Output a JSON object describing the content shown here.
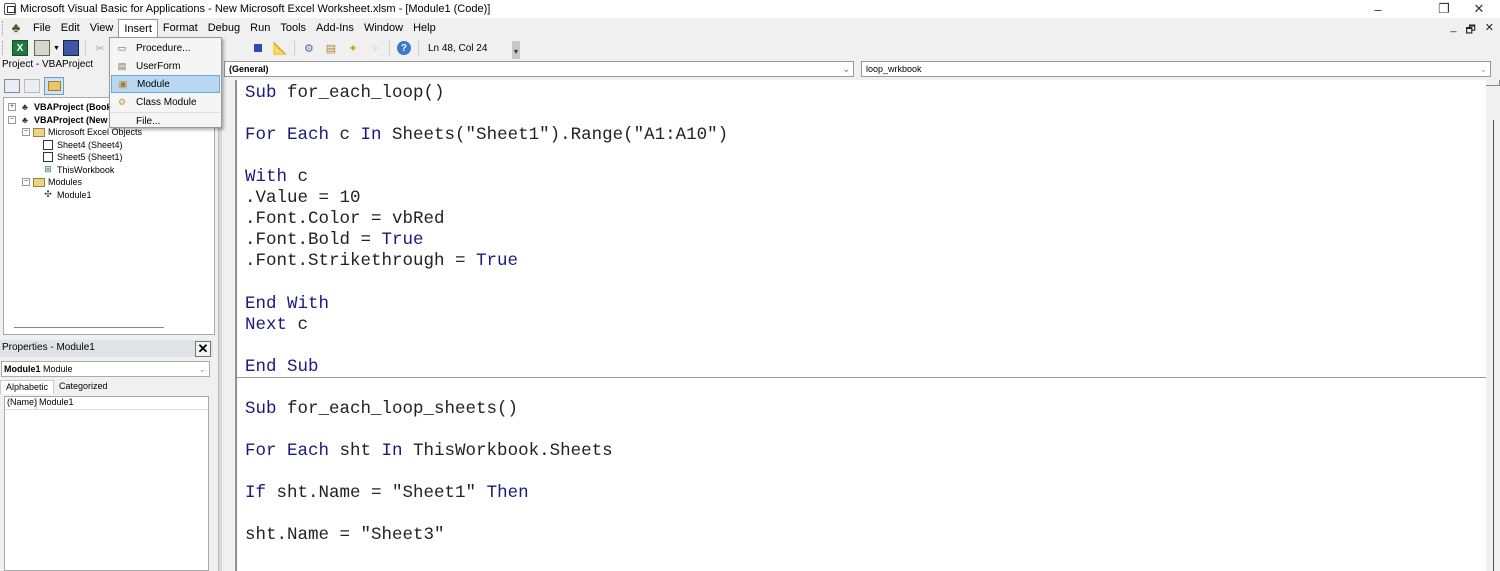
{
  "window": {
    "title": "Microsoft Visual Basic for Applications - New Microsoft Excel Worksheet.xlsm - [Module1 (Code)]",
    "controls": {
      "minimize": "–",
      "restore": "❐",
      "close": "✕"
    },
    "mdi_controls": {
      "minimize": "_",
      "restore": "🗗",
      "close": "✕"
    }
  },
  "menubar": {
    "items": [
      "File",
      "Edit",
      "View",
      "Insert",
      "Format",
      "Debug",
      "Run",
      "Tools",
      "Add-Ins",
      "Window",
      "Help"
    ],
    "open_menu": "Insert"
  },
  "insert_menu": {
    "items": [
      {
        "label": "Procedure...",
        "icon": "procedure-icon",
        "highlighted": false
      },
      {
        "label": "UserForm",
        "icon": "userform-icon",
        "highlighted": false
      },
      {
        "label": "Module",
        "icon": "module-icon",
        "highlighted": true
      },
      {
        "label": "Class Module",
        "icon": "class-module-icon",
        "highlighted": false
      },
      {
        "label": "File...",
        "icon": "",
        "highlighted": false
      }
    ]
  },
  "toolbar": {
    "status": "Ln 48, Col 24",
    "icons": [
      "excel-view-icon",
      "insert-userform-icon",
      "save-icon",
      "cut-icon",
      "copy-icon",
      "reset-icon",
      "design-mode-icon",
      "project-explorer-icon",
      "properties-window-icon",
      "object-browser-icon",
      "toolbox-icon",
      "help-icon"
    ]
  },
  "project_panel": {
    "title": "Project - VBAProject",
    "tree": [
      {
        "label": "VBAProject (Book",
        "level": 0,
        "bold": true,
        "expander": "+",
        "icon": "vba-project-icon"
      },
      {
        "label": "VBAProject (New",
        "level": 0,
        "bold": true,
        "expander": "−",
        "icon": "vba-project-icon"
      },
      {
        "label": "Microsoft Excel Objects",
        "level": 1,
        "bold": false,
        "expander": "−",
        "icon": "folder-icon"
      },
      {
        "label": "Sheet4 (Sheet4)",
        "level": 2,
        "bold": false,
        "expander": "",
        "icon": "sheet-icon"
      },
      {
        "label": "Sheet5 (Sheet1)",
        "level": 2,
        "bold": false,
        "expander": "",
        "icon": "sheet-icon"
      },
      {
        "label": "ThisWorkbook",
        "level": 2,
        "bold": false,
        "expander": "",
        "icon": "workbook-icon"
      },
      {
        "label": "Modules",
        "level": 1,
        "bold": false,
        "expander": "−",
        "icon": "folder-icon"
      },
      {
        "label": "Module1",
        "level": 2,
        "bold": false,
        "expander": "",
        "icon": "module-icon"
      }
    ]
  },
  "properties_panel": {
    "title": "Properties - Module1",
    "close": "✕",
    "object_name": "Module1",
    "object_type": "Module",
    "tabs": [
      "Alphabetic",
      "Categorized"
    ],
    "active_tab": "Alphabetic",
    "rows": [
      {
        "name": "(Name)",
        "value": "Module1"
      }
    ]
  },
  "code_window": {
    "object_combo": "(General)",
    "procedure_combo": "loop_wrkbook",
    "lines": [
      [
        [
          "kw",
          "Sub"
        ],
        [
          "t",
          " for_each_loop()"
        ]
      ],
      [],
      [
        [
          "kw",
          "For Each"
        ],
        [
          "t",
          " c "
        ],
        [
          "kw",
          "In"
        ],
        [
          "t",
          " Sheets(\"Sheet1\").Range(\"A1:A10\")"
        ]
      ],
      [],
      [
        [
          "kw",
          "With"
        ],
        [
          "t",
          " c"
        ]
      ],
      [
        [
          "t",
          ".Value = 10"
        ]
      ],
      [
        [
          "t",
          ".Font.Color = vbRed"
        ]
      ],
      [
        [
          "t",
          ".Font.Bold = "
        ],
        [
          "kw",
          "True"
        ]
      ],
      [
        [
          "t",
          ".Font.Strikethrough = "
        ],
        [
          "kw",
          "True"
        ]
      ],
      [],
      [
        [
          "kw",
          "End With"
        ]
      ],
      [
        [
          "kw",
          "Next"
        ],
        [
          "t",
          " c"
        ]
      ],
      [],
      [
        [
          "kw",
          "End Sub"
        ]
      ],
      [],
      [
        [
          "kw",
          "Sub"
        ],
        [
          "t",
          " for_each_loop_sheets()"
        ]
      ],
      [],
      [
        [
          "kw",
          "For Each"
        ],
        [
          "t",
          " sht "
        ],
        [
          "kw",
          "In"
        ],
        [
          "t",
          " ThisWorkbook.Sheets"
        ]
      ],
      [],
      [
        [
          "kw",
          "If"
        ],
        [
          "t",
          " sht.Name = \"Sheet1\" "
        ],
        [
          "kw",
          "Then"
        ]
      ],
      [],
      [
        [
          "t",
          "sht.Name = \"Sheet3\""
        ]
      ]
    ]
  },
  "colors": {
    "keyword": "#1a1a7a",
    "code_text": "#222222",
    "menu_highlight": "#b8d8f2"
  }
}
